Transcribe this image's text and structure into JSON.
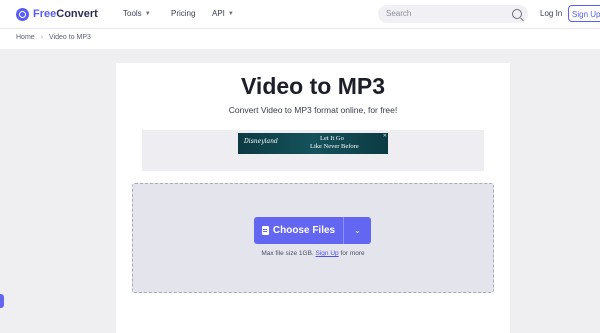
{
  "header": {
    "logo_part1": "Free",
    "logo_part2": "Convert",
    "nav": [
      {
        "label": "Tools",
        "has_dropdown": true
      },
      {
        "label": "Pricing",
        "has_dropdown": false
      },
      {
        "label": "API",
        "has_dropdown": true
      }
    ],
    "search_placeholder": "Search",
    "login_label": "Log In",
    "signup_label": "Sign Up"
  },
  "breadcrumb": [
    "Home",
    "Video to MP3"
  ],
  "main": {
    "title": "Video to MP3",
    "subtitle": "Convert Video to MP3 format online, for free!"
  },
  "ad": {
    "brand": "Disneyland",
    "line1": "Let It Go",
    "line2": "Like Never Before"
  },
  "upload": {
    "choose_label": "Choose Files",
    "max_prefix": "Max file size 1GB.",
    "max_link": "Sign Up",
    "max_suffix": "for more"
  },
  "colors": {
    "accent": "#6366f1",
    "background": "#efeff2",
    "dropzone": "#e4e4ed"
  }
}
